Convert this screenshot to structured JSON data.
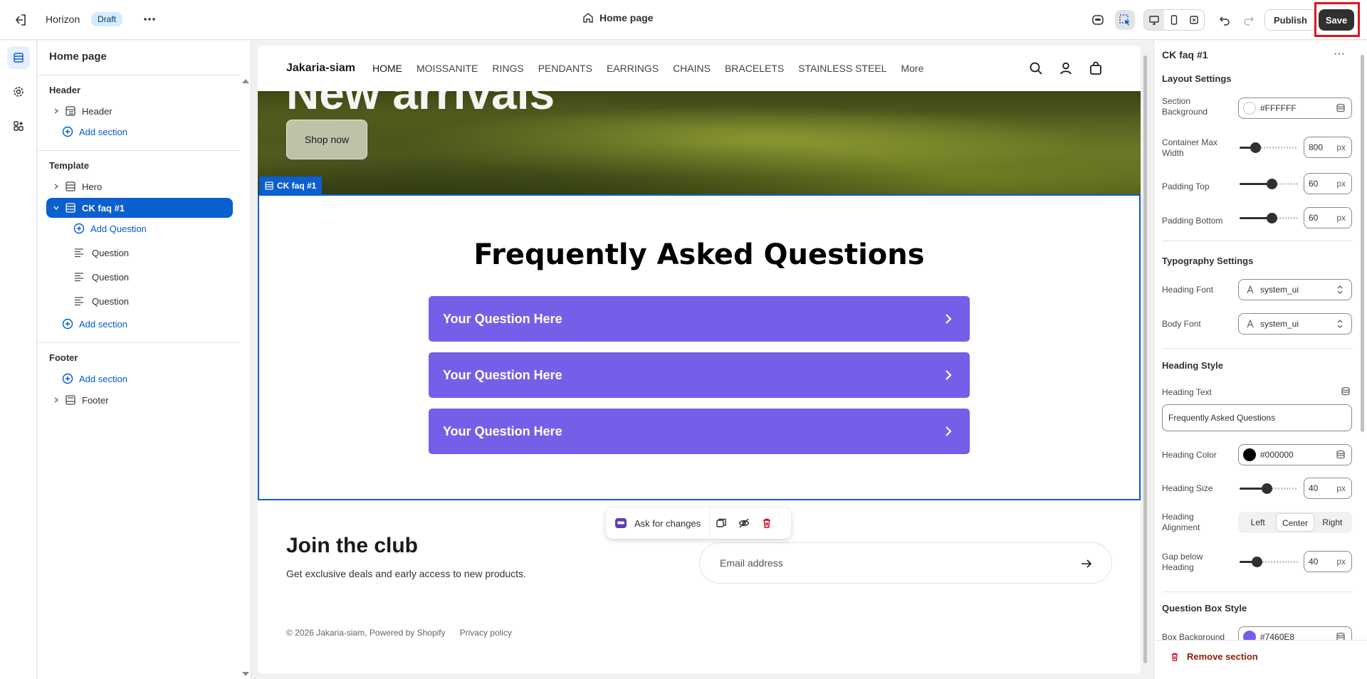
{
  "topbar": {
    "theme_name": "Horizon",
    "status_badge": "Draft",
    "page_selector": "Home page",
    "publish_label": "Publish",
    "save_label": "Save"
  },
  "sidebar": {
    "title": "Home page",
    "header_group": "Header",
    "header_item": "Header",
    "add_section": "Add section",
    "template_group": "Template",
    "hero_item": "Hero",
    "faq_item": "CK faq #1",
    "add_question": "Add Question",
    "questions": [
      "Question",
      "Question",
      "Question"
    ],
    "footer_group": "Footer",
    "footer_item": "Footer"
  },
  "preview": {
    "logo": "Jakaria-siam",
    "nav": [
      "HOME",
      "MOISSANITE",
      "RINGS",
      "PENDANTS",
      "EARRINGS",
      "CHAINS",
      "BRACELETS",
      "STAINLESS STEEL",
      "More"
    ],
    "hero_title": "New arrivals",
    "shop_button": "Shop now",
    "section_tag": "CK faq #1",
    "faq_title": "Frequently Asked Questions",
    "faq_questions": [
      "Your Question Here",
      "Your Question Here",
      "Your Question Here"
    ],
    "join_title": "Join the club",
    "join_subtitle": "Get exclusive deals and early access to new products.",
    "email_placeholder": "Email address",
    "copyright": "© 2026 Jakaria-siam, Powered by Shopify",
    "privacy": "Privacy policy"
  },
  "floating_toolbar": {
    "ask_label": "Ask for changes"
  },
  "settings": {
    "title": "CK faq #1",
    "layout_heading": "Layout Settings",
    "section_bg_label": "Section Background",
    "section_bg_value": "#FFFFFF",
    "container_label": "Container Max Width",
    "container_value": "800",
    "padding_top_label": "Padding Top",
    "padding_top_value": "60",
    "padding_bottom_label": "Padding Bottom",
    "padding_bottom_value": "60",
    "unit": "px",
    "typography_heading": "Typography Settings",
    "heading_font_label": "Heading Font",
    "heading_font_value": "system_ui",
    "body_font_label": "Body Font",
    "body_font_value": "system_ui",
    "heading_style_heading": "Heading Style",
    "heading_text_label": "Heading Text",
    "heading_text_value": "Frequently Asked Questions",
    "heading_color_label": "Heading Color",
    "heading_color_value": "#000000",
    "heading_size_label": "Heading Size",
    "heading_size_value": "40",
    "alignment_label": "Heading Alignment",
    "alignment_options": [
      "Left",
      "Center",
      "Right"
    ],
    "alignment_selected": "Center",
    "gap_label": "Gap below Heading",
    "gap_value": "40",
    "question_box_heading": "Question Box Style",
    "box_bg_label": "Box Background",
    "box_bg_value": "#7460E8",
    "remove_label": "Remove section"
  },
  "colors": {
    "accent": "#0a5fd1",
    "faq_box": "#7460e8",
    "save_bg": "#303030",
    "highlight": "#e0141e"
  }
}
